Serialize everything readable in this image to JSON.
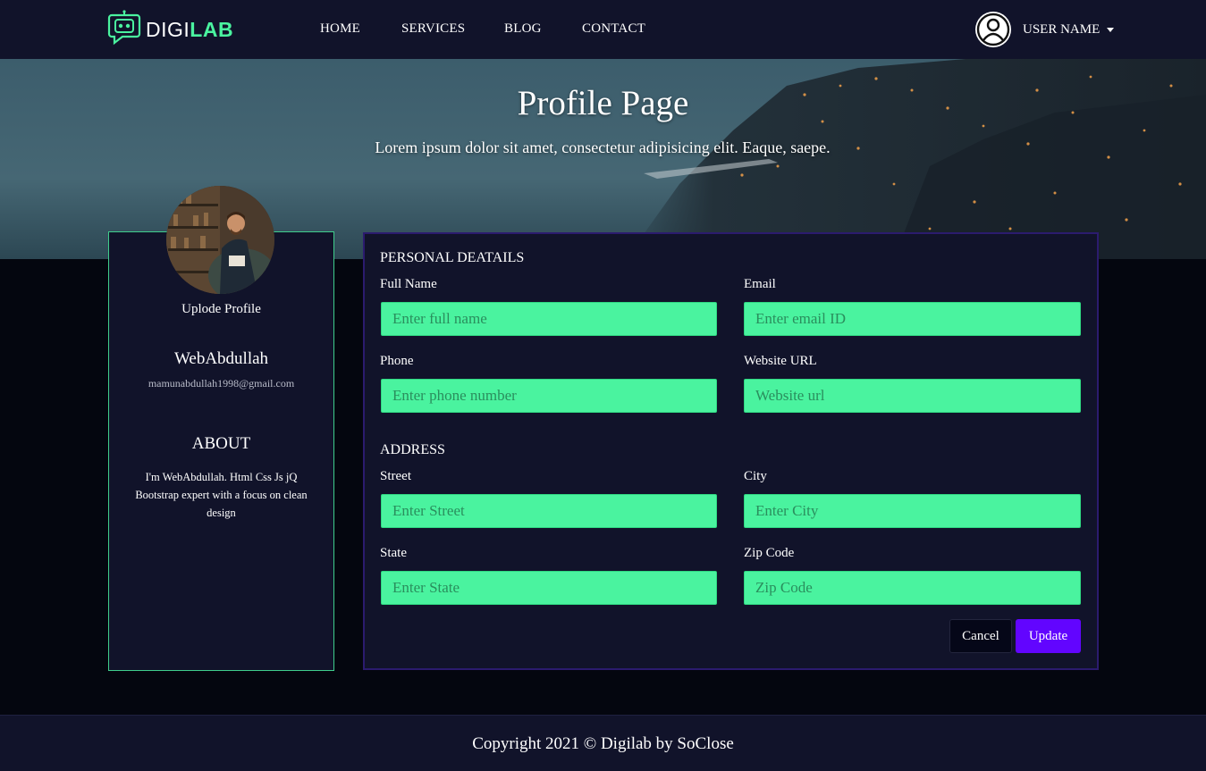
{
  "brand": {
    "logo_part1": "DIGI",
    "logo_part2": "LAB",
    "accent": "#4af39f",
    "icon": "robot-chat-icon"
  },
  "nav": {
    "items": [
      "HOME",
      "SERVICES",
      "BLOG",
      "CONTACT"
    ]
  },
  "user": {
    "name": "USER NAME",
    "icon": "user-circle-icon"
  },
  "hero": {
    "title": "Profile Page",
    "subtitle": "Lorem ipsum dolor sit amet, consectetur adipisicing elit. Eaque, saepe."
  },
  "profile": {
    "upload_label": "Uplode Profile",
    "name": "WebAbdullah",
    "email": "mamunabdullah1998@gmail.com",
    "about_title": "ABOUT",
    "about_text": "I'm WebAbdullah. Html Css Js jQ Bootstrap expert with a focus on clean design"
  },
  "form": {
    "personal_title": "PERSONAL DEATAILS",
    "address_title": "ADDRESS",
    "fields": {
      "full_name": {
        "label": "Full Name",
        "placeholder": "Enter full name",
        "value": ""
      },
      "email": {
        "label": "Email",
        "placeholder": "Enter email ID",
        "value": ""
      },
      "phone": {
        "label": "Phone",
        "placeholder": "Enter phone number",
        "value": ""
      },
      "website": {
        "label": "Website URL",
        "placeholder": "Website url",
        "value": ""
      },
      "street": {
        "label": "Street",
        "placeholder": "Enter Street",
        "value": ""
      },
      "city": {
        "label": "City",
        "placeholder": "Enter City",
        "value": ""
      },
      "state": {
        "label": "State",
        "placeholder": "Enter State",
        "value": ""
      },
      "zip": {
        "label": "Zip Code",
        "placeholder": "Zip Code",
        "value": ""
      }
    },
    "cancel_label": "Cancel",
    "update_label": "Update",
    "input_color": "#4af39f",
    "update_color": "#6205ff"
  },
  "footer": {
    "text": "Copyright 2021 © Digilab by SoClose"
  }
}
